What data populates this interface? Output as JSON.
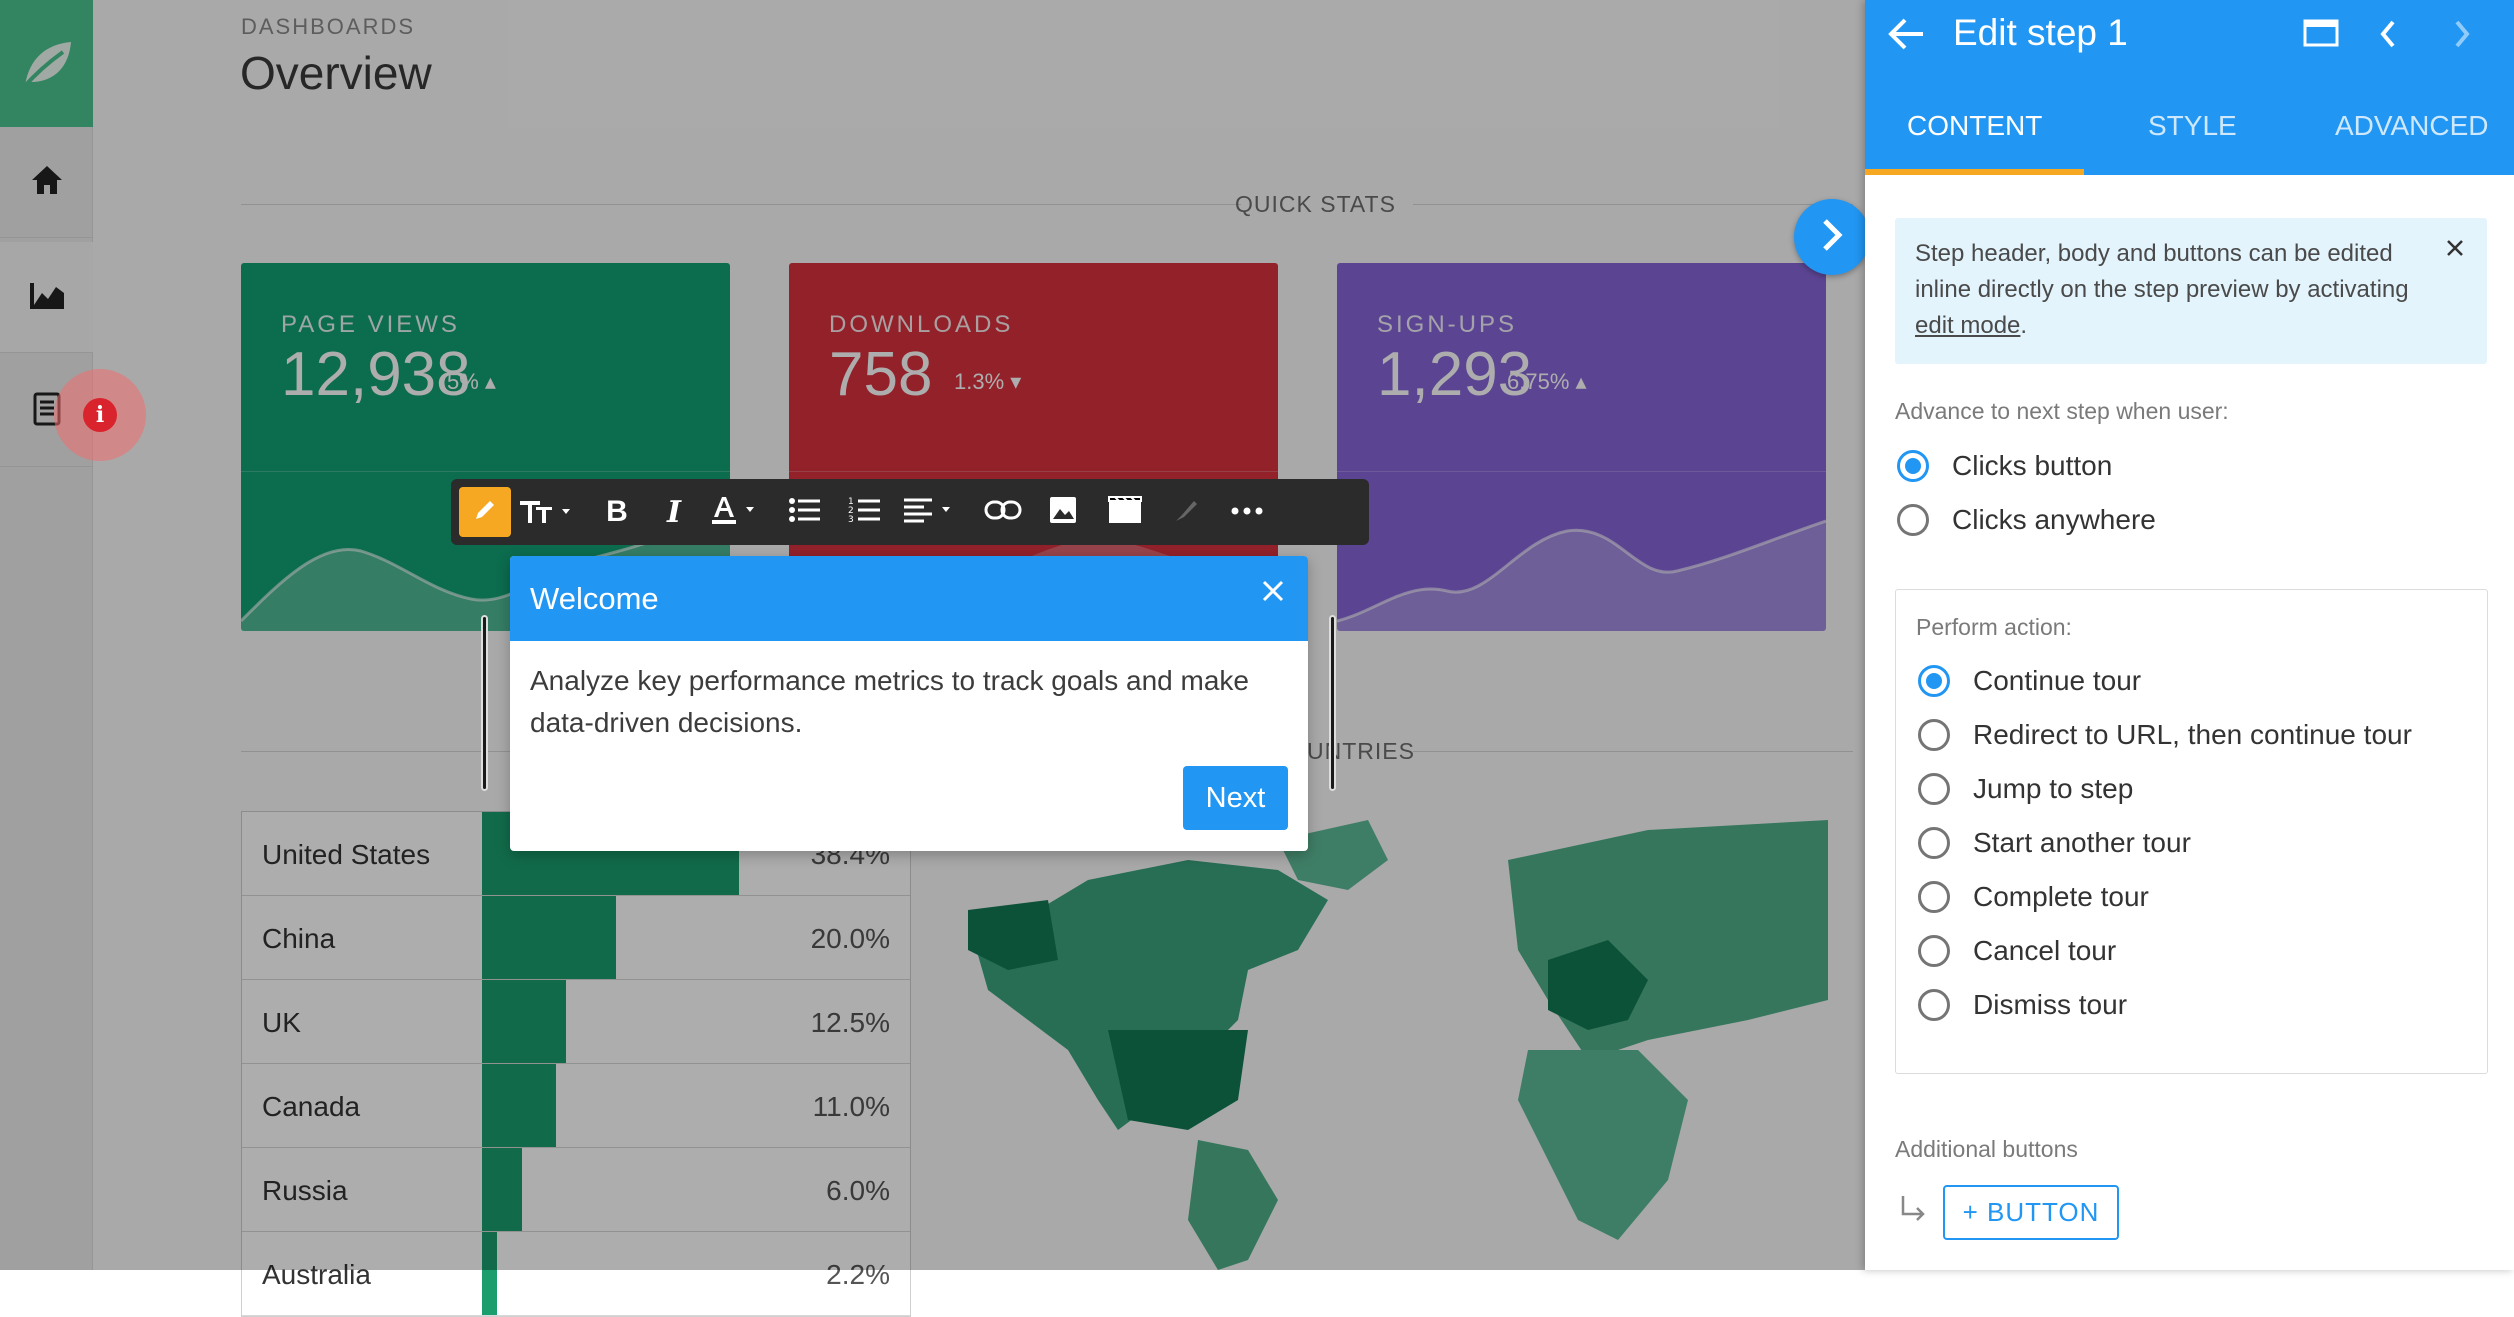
{
  "dashboard": {
    "breadcrumb": "DASHBOARDS",
    "title": "Overview",
    "quick_stats_label": "QUICK STATS",
    "countries_label": "UNTRIES",
    "stats": [
      {
        "label": "PAGE VIEWS",
        "value": "12,938",
        "delta": "5%",
        "trend": "up",
        "color": "#13a073"
      },
      {
        "label": "DOWNLOADS",
        "value": "758",
        "delta": "1.3%",
        "trend": "down",
        "color": "#d7313f"
      },
      {
        "label": "SIGN-UPS",
        "value": "1,293",
        "delta": "6.75%",
        "trend": "up",
        "color": "#8666d8"
      }
    ],
    "countries": [
      {
        "name": "United States",
        "value": "38.4%",
        "share": 0.384
      },
      {
        "name": "China",
        "value": "20.0%",
        "share": 0.2
      },
      {
        "name": "UK",
        "value": "12.5%",
        "share": 0.125
      },
      {
        "name": "Canada",
        "value": "11.0%",
        "share": 0.11
      },
      {
        "name": "Russia",
        "value": "6.0%",
        "share": 0.06
      },
      {
        "name": "Australia",
        "value": "2.2%",
        "share": 0.022
      }
    ]
  },
  "sidenav": {
    "items": [
      {
        "icon": "home-icon"
      },
      {
        "icon": "area-chart-icon"
      },
      {
        "icon": "document-icon"
      }
    ],
    "notification_icon": "i"
  },
  "toolbar": {
    "buttons": [
      "edit-mode-icon",
      "text-size-icon",
      "bold-icon",
      "italic-icon",
      "text-color-icon",
      "bullet-list-icon",
      "numbered-list-icon",
      "align-icon",
      "link-icon",
      "image-icon",
      "video-icon",
      "brush-icon",
      "more-icon"
    ]
  },
  "popup": {
    "title": "Welcome",
    "body": "Analyze key performance metrics to track goals and make data-driven decisions.",
    "next_label": "Next"
  },
  "panel": {
    "title": "Edit step 1",
    "tabs": [
      "CONTENT",
      "STYLE",
      "ADVANCED"
    ],
    "active_tab": "CONTENT",
    "info_text": "Step header, body and buttons can be edited inline directly on the step preview by activating",
    "info_link": "edit mode",
    "advance_label": "Advance to next step when user:",
    "advance_options": [
      {
        "label": "Clicks button",
        "selected": true
      },
      {
        "label": "Clicks anywhere",
        "selected": false
      }
    ],
    "perform_label": "Perform action:",
    "perform_options": [
      {
        "label": "Continue tour",
        "selected": true
      },
      {
        "label": "Redirect to URL, then continue tour",
        "selected": false
      },
      {
        "label": "Jump to step",
        "selected": false
      },
      {
        "label": "Start another tour",
        "selected": false
      },
      {
        "label": "Complete tour",
        "selected": false
      },
      {
        "label": "Cancel tour",
        "selected": false
      },
      {
        "label": "Dismiss tour",
        "selected": false
      }
    ],
    "additional_label": "Additional buttons",
    "add_button_label": "+ BUTTON"
  },
  "colors": {
    "accent": "#2196f3",
    "highlight": "#f7a823",
    "map_green": "#1a9e6e"
  }
}
